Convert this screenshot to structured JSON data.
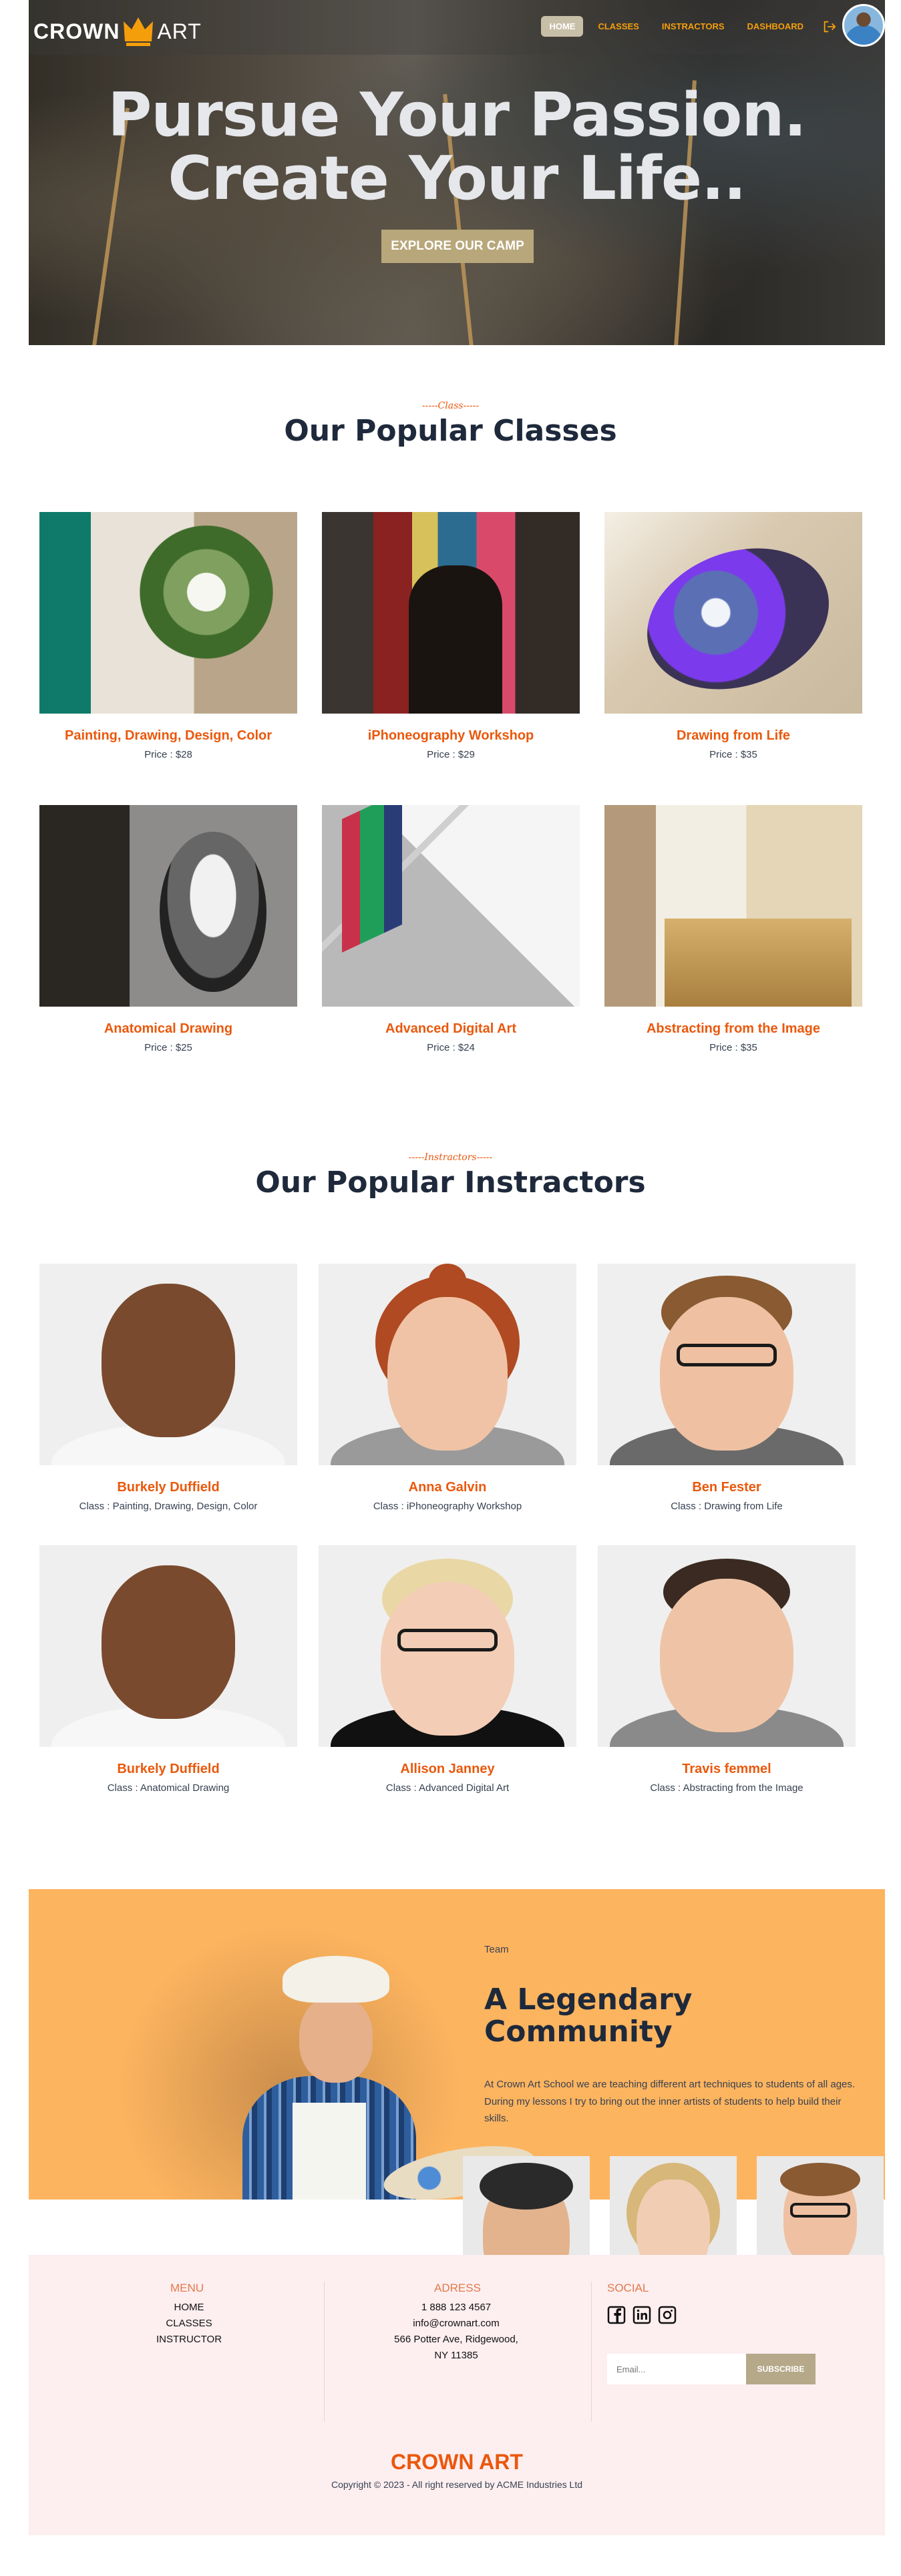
{
  "brand": {
    "name_part1": "CROWN",
    "name_part2": "ART",
    "accent": "#f59e0b",
    "orange": "#ea580c"
  },
  "nav": {
    "items": [
      {
        "label": "HOME",
        "active": true
      },
      {
        "label": "CLASSES",
        "active": false
      },
      {
        "label": "INSTRACTORS",
        "active": false
      },
      {
        "label": "DASHBOARD",
        "active": false
      }
    ],
    "logout_icon": "logout-icon",
    "avatar_icon": "user-avatar"
  },
  "hero": {
    "line1": "Pursue Your Passion.",
    "line2": "Create Your Life..",
    "cta": "EXPLORE OUR CAMP"
  },
  "classes": {
    "eyebrow": "-----Class-----",
    "title": "Our Popular Classes",
    "price_prefix": "Price : ",
    "items": [
      {
        "name": "Painting, Drawing, Design, Color",
        "price": "Price : $28"
      },
      {
        "name": "iPhoneography Workshop",
        "price": "Price : $29"
      },
      {
        "name": "Drawing from Life",
        "price": "Price : $35"
      },
      {
        "name": "Anatomical Drawing",
        "price": "Price : $25"
      },
      {
        "name": "Advanced Digital Art",
        "price": "Price : $24"
      },
      {
        "name": "Abstracting from the Image",
        "price": "Price : $35"
      }
    ]
  },
  "instructors": {
    "eyebrow": "-----Instractors-----",
    "title": "Our Popular Instractors",
    "items": [
      {
        "name": "Burkely Duffield",
        "class": "Class : Painting, Drawing, Design, Color"
      },
      {
        "name": "Anna Galvin",
        "class": "Class : iPhoneography Workshop"
      },
      {
        "name": "Ben Fester",
        "class": "Class : Drawing from Life"
      },
      {
        "name": "Burkely Duffield",
        "class": "Class : Anatomical Drawing"
      },
      {
        "name": "Allison Janney",
        "class": "Class : Advanced Digital Art"
      },
      {
        "name": "Travis femmel",
        "class": "Class : Abstracting from the Image"
      }
    ]
  },
  "community": {
    "eyebrow": "Team",
    "title_line1": "A Legendary",
    "title_line2": "Community",
    "text": "At Crown Art School we are teaching different art techniques to students of all ages. During my lessons I try to bring out the inner artists of students to help build their skills."
  },
  "footer": {
    "menu": {
      "title": "MENU",
      "items": [
        "HOME",
        "CLASSES",
        "INSTRUCTOR"
      ]
    },
    "address": {
      "title": "ADRESS",
      "lines": [
        "1 888 123 4567",
        "info@crownart.com",
        "566 Potter Ave, Ridgewood,",
        "NY 11385"
      ]
    },
    "social": {
      "title": "SOCIAL",
      "icons": [
        "facebook-icon",
        "linkedin-icon",
        "instagram-icon"
      ]
    },
    "email_placeholder": "Email...",
    "subscribe": "SUBSCRIBE",
    "brand": "CROWN ART",
    "copyright": "Copyright © 2023 - All right reserved by ACME Industries Ltd"
  }
}
